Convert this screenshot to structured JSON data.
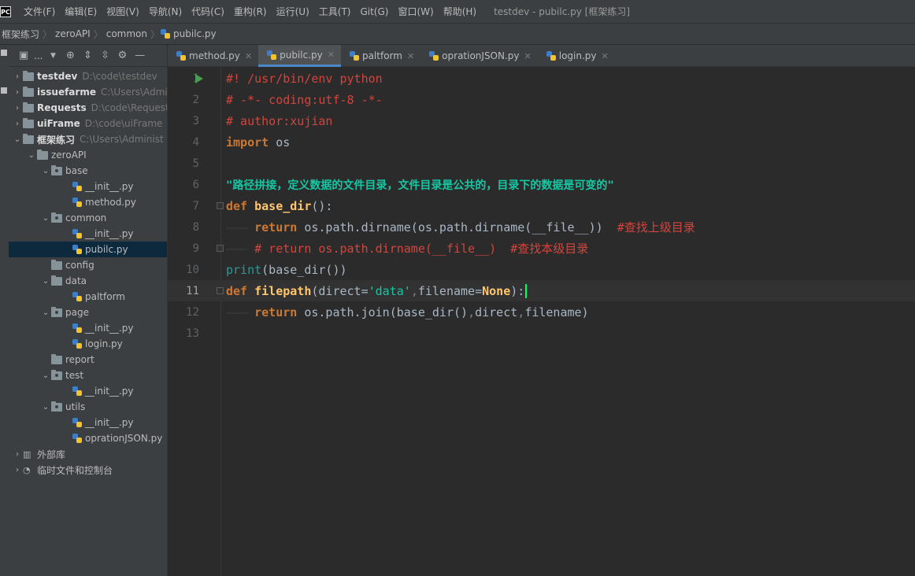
{
  "app": {
    "icon_label": "PC",
    "window_title": "testdev - pubilc.py [框架练习]"
  },
  "menu": [
    "文件(F)",
    "编辑(E)",
    "视图(V)",
    "导航(N)",
    "代码(C)",
    "重构(R)",
    "运行(U)",
    "工具(T)",
    "Git(G)",
    "窗口(W)",
    "帮助(H)"
  ],
  "breadcrumbs": [
    "框架练习",
    "zeroAPI",
    "common",
    "pubilc.py"
  ],
  "toolbar": {
    "dropdown_label": "..."
  },
  "tree": [
    {
      "label": "testdev",
      "path": "D:\\code\\testdev"
    },
    {
      "label": "issuefarme",
      "path": "C:\\Users\\Admi"
    },
    {
      "label": "Requests",
      "path": "D:\\code\\Request"
    },
    {
      "label": "uiFrame",
      "path": "D:\\code\\uiFrame"
    },
    {
      "label": "框架练习",
      "path": "C:\\Users\\Administ"
    },
    {
      "label": "zeroAPI",
      "path": ""
    },
    {
      "label": "base",
      "path": ""
    },
    {
      "label": "__init__.py",
      "path": ""
    },
    {
      "label": "method.py",
      "path": ""
    },
    {
      "label": "common",
      "path": ""
    },
    {
      "label": "__init__.py",
      "path": ""
    },
    {
      "label": "pubilc.py",
      "path": ""
    },
    {
      "label": "config",
      "path": ""
    },
    {
      "label": "data",
      "path": ""
    },
    {
      "label": "paltform",
      "path": ""
    },
    {
      "label": "page",
      "path": ""
    },
    {
      "label": "__init__.py",
      "path": ""
    },
    {
      "label": "login.py",
      "path": ""
    },
    {
      "label": "report",
      "path": ""
    },
    {
      "label": "test",
      "path": ""
    },
    {
      "label": "__init__.py",
      "path": ""
    },
    {
      "label": "utils",
      "path": ""
    },
    {
      "label": "__init__.py",
      "path": ""
    },
    {
      "label": "oprationJSON.py",
      "path": ""
    },
    {
      "label": "外部库",
      "path": ""
    },
    {
      "label": "临时文件和控制台",
      "path": ""
    }
  ],
  "tabs": [
    "method.py",
    "pubilc.py",
    "paltform",
    "oprationJSON.py",
    "login.py"
  ],
  "line_numbers": [
    "1",
    "2",
    "3",
    "4",
    "5",
    "6",
    "7",
    "8",
    "9",
    "10",
    "11",
    "12",
    "13"
  ],
  "code": {
    "l1": "#! /usr/bin/env python",
    "l2": "# -*- coding:utf-8 -*-",
    "l3": "# author:xujian",
    "l4_kw": "import",
    "l4_mod": " os",
    "l6": "\"路径拼接，定义数据的文件目录，文件目录是公共的，目录下的数据是可变的\"",
    "l7_kw": "def",
    "l7_fn": "base_dir",
    "l7_rest": "():",
    "l8_kw": "return",
    "l8_code": " os.path.dirname(os.path.dirname(__file__))",
    "l8_cm": "#查找上级目录",
    "l9_code": "# return os.path.dirname(__file__)",
    "l9_cm": "#查找本级目录",
    "l10_print": "print",
    "l10_rest": "(base_dir())",
    "l11_kw": "def",
    "l11_fn": "filepath",
    "l11_p1": "(direct",
    "l11_eq1": "=",
    "l11_str": "'data'",
    "l11_comma": ",",
    "l11_p2": "filename",
    "l11_eq2": "=",
    "l11_none": "None",
    "l11_end": "):",
    "l12_kw": "return",
    "l12_code": " os.path.join(base_dir()",
    "l12_c1": ",",
    "l12_mid": "direct",
    "l12_c2": ",",
    "l12_end": "filename)"
  },
  "colors": {
    "editor_bg": "#2b2b2b",
    "panel_bg": "#3c3f41",
    "selected_row": "#0d293e",
    "tab_accent": "#4a88c7",
    "comment_red": "#d3453d"
  }
}
